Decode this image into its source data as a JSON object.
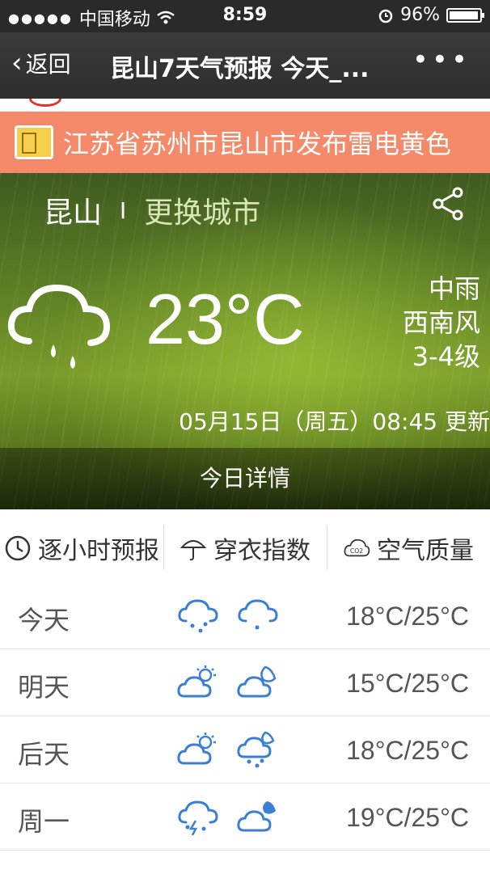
{
  "status_bar": {
    "signal_dots": "●●●●●",
    "carrier": "中国移动",
    "time": "8:59",
    "battery": "96%",
    "battery_level": 0.96
  },
  "nav": {
    "back_label": "返回",
    "title": "昆山7天气预报 今天_...",
    "more_icon": "ellipsis-icon"
  },
  "alert": {
    "text": "江苏省苏州市昆山市发布雷电黄色",
    "color": "#f48a6a",
    "icon": "warning-sign-icon"
  },
  "current": {
    "city": "昆山",
    "separator": "I",
    "change_city": "更换城市",
    "temperature": "23°C",
    "condition": "中雨",
    "wind_direction": "西南风",
    "wind_level": "3-4级",
    "updated": "05月15日（周五）08:45 更新",
    "today_detail": "今日详情"
  },
  "tabs": [
    {
      "label": "逐小时预报",
      "icon": "clock-icon"
    },
    {
      "label": "穿衣指数",
      "icon": "umbrella-icon"
    },
    {
      "label": "空气质量",
      "icon": "co2-cloud-icon"
    }
  ],
  "forecast": [
    {
      "day": "今天",
      "day_icon": "cloud-rain-icon",
      "night_icon": "cloud-rain-icon",
      "range": "18°C/25°C"
    },
    {
      "day": "明天",
      "day_icon": "sun-cloud-icon",
      "night_icon": "moon-cloud-icon",
      "range": "15°C/25°C"
    },
    {
      "day": "后天",
      "day_icon": "sun-cloud-icon",
      "night_icon": "moon-cloud-rain-icon",
      "range": "18°C/25°C"
    },
    {
      "day": "周一",
      "day_icon": "cloud-thunder-icon",
      "night_icon": "moon-cloud-icon",
      "range": "19°C/25°C"
    }
  ],
  "colors": {
    "accent_blue": "#3a7fd5",
    "alert_orange": "#f48a6a"
  }
}
